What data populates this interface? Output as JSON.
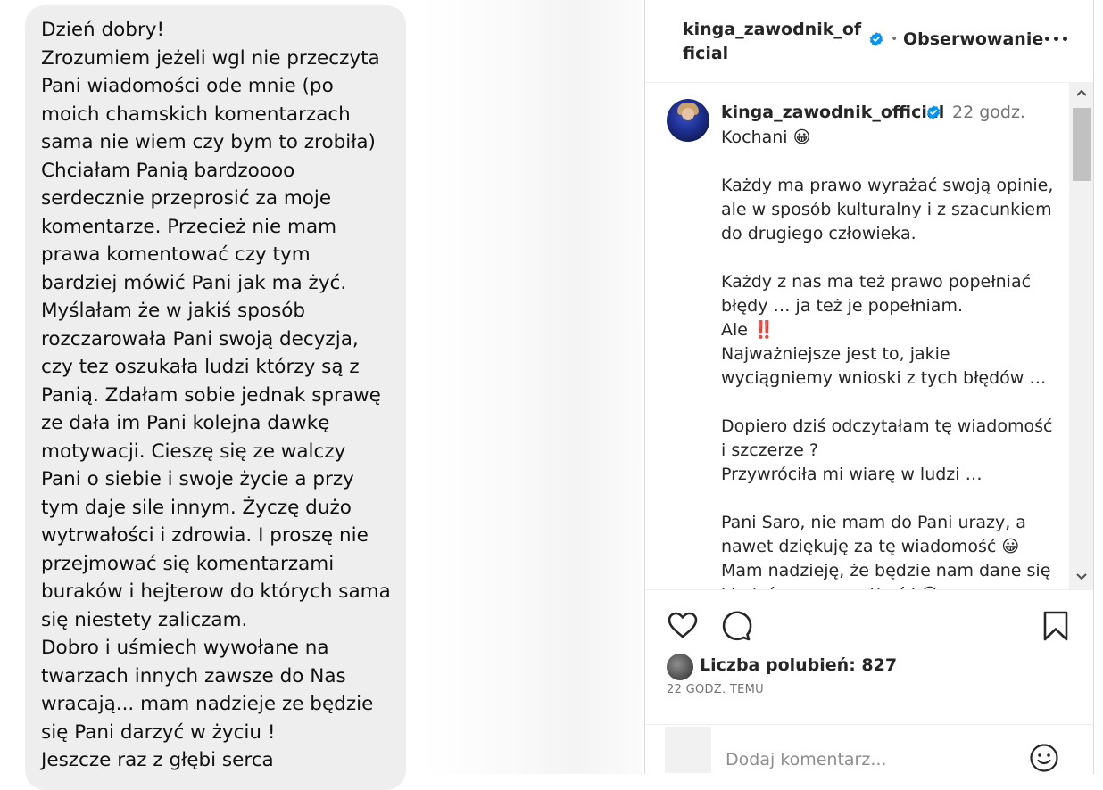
{
  "message_bubble": {
    "lines": [
      "Dzień dobry!",
      "Zrozumiem jeżeli wgl nie przeczyta",
      "Pani wiadomości ode mnie (po",
      "moich chamskich komentarzach",
      "sama nie wiem czy bym to zrobiła)",
      "Chciałam Panią bardzoooo",
      "serdecznie przeprosić za moje",
      "komentarze. Przecież nie mam",
      "prawa komentować czy tym",
      "bardziej mówić Pani jak ma żyć.",
      "Myślałam że w jakiś sposób",
      "rozczarowała Pani swoją decyzja,",
      "czy tez oszukała ludzi którzy są z",
      "Panią. Zdałam sobie jednak sprawę",
      "ze dała im Pani kolejna dawkę",
      "motywacji. Cieszę się ze walczy",
      "Pani o siebie i swoje życie a przy",
      "tym daje sile innym. Życzę dużo",
      "wytrwałości i zdrowia. I proszę nie",
      "przejmować się komentarzami",
      "buraków i hejterow do których sama",
      "się niestety zaliczam.",
      "Dobro i uśmiech wywołane na",
      "twarzach innych zawsze do Nas",
      "wracają... mam nadzieje ze będzie",
      "się Pani darzyć w życiu !",
      "Jeszcze raz z głębi serca"
    ]
  },
  "post_header": {
    "username": "kinga_zawodnik_official",
    "separator": "•",
    "follow_label": "Obserwowanie",
    "more_icon": "more-horizontal-icon",
    "verified_color": "#0095f6"
  },
  "caption": {
    "username": "kinga_zawodnik_official",
    "time": "22 godz.",
    "lines": [
      "Kochani 😀",
      "",
      "Każdy ma prawo wyrażać swoją opinie,",
      "ale w sposób kulturalny i z szacunkiem",
      "do drugiego człowieka.",
      "",
      "Każdy z nas ma też prawo popełniać",
      "błędy … ja też je popełniam.",
      "Ale ‼️",
      "Najważniejsze jest to, jakie",
      "wyciągniemy wnioski z tych błędów …",
      "",
      "Dopiero dziś odczytałam tę wiadomość",
      "i szczerze ?",
      "Przywróciła mi wiarę w ludzi …",
      "",
      "Pani Saro, nie mam do Pani urazy, a",
      "nawet dziękuję za tę wiadomość 😀",
      "Mam nadzieję, że będzie nam dane się",
      "kiedyś razem spotkać i 😀"
    ]
  },
  "actions": {
    "like_icon": "heart-icon",
    "comment_icon": "comment-icon",
    "save_icon": "bookmark-icon"
  },
  "likes": {
    "label": "Liczba polubień: 827"
  },
  "post_date": "22 GODZ. TEMU",
  "comment": {
    "placeholder": "Dodaj komentarz...",
    "emoji_icon": "smiley-icon"
  }
}
